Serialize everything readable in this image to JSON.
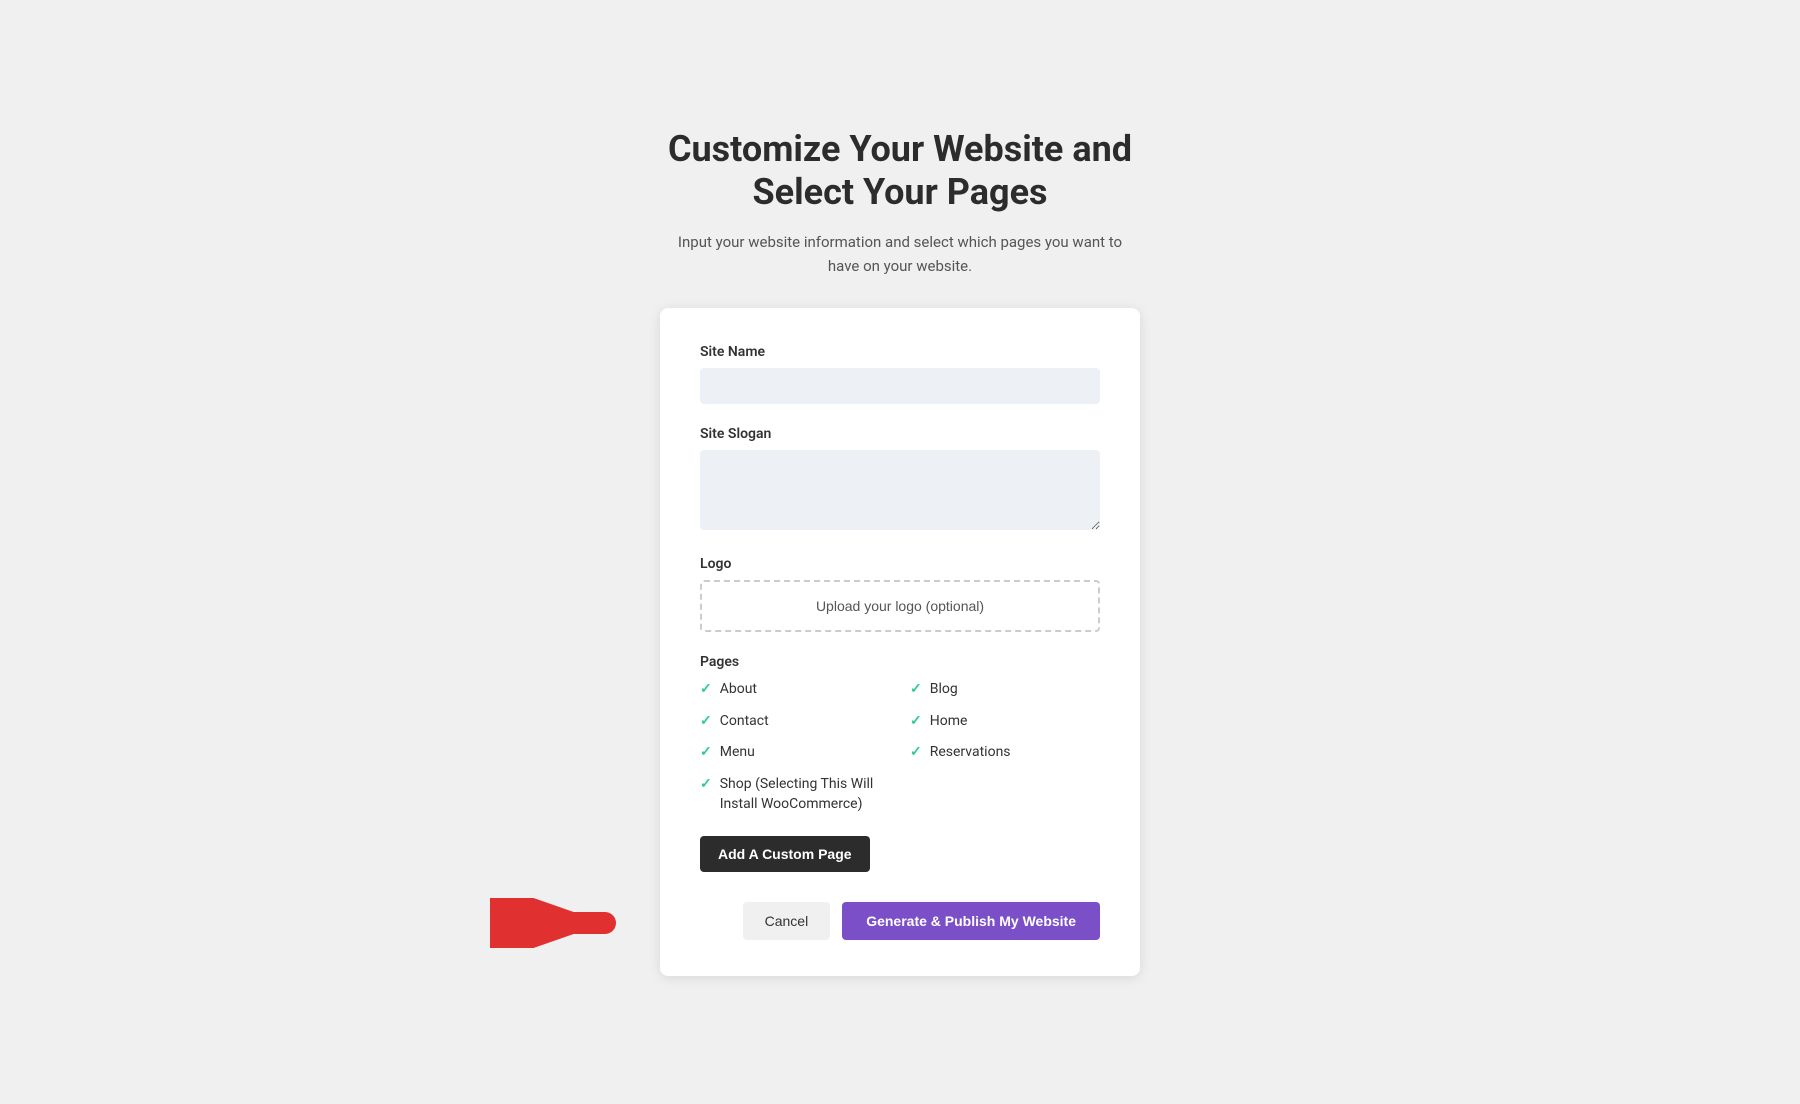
{
  "page": {
    "title_line1": "Customize Your Website and",
    "title_line2": "Select Your Pages",
    "subtitle": "Input your website information and select which pages you want to have on your website."
  },
  "form": {
    "site_name_label": "Site Name",
    "site_name_placeholder": "",
    "site_slogan_label": "Site Slogan",
    "site_slogan_placeholder": "",
    "logo_label": "Logo",
    "logo_upload_text": "Upload your logo (optional)",
    "pages_label": "Pages",
    "pages": [
      {
        "id": "about",
        "label": "About",
        "checked": true,
        "col": 1
      },
      {
        "id": "blog",
        "label": "Blog",
        "checked": true,
        "col": 2
      },
      {
        "id": "contact",
        "label": "Contact",
        "checked": true,
        "col": 1
      },
      {
        "id": "home",
        "label": "Home",
        "checked": true,
        "col": 2
      },
      {
        "id": "menu",
        "label": "Menu",
        "checked": true,
        "col": 1
      },
      {
        "id": "reservations",
        "label": "Reservations",
        "checked": true,
        "col": 2
      },
      {
        "id": "shop",
        "label": "Shop (Selecting This Will Install WooCommerce)",
        "checked": true,
        "col": 1
      }
    ],
    "add_custom_page_label": "Add A Custom Page",
    "cancel_label": "Cancel",
    "generate_label": "Generate & Publish My Website"
  }
}
